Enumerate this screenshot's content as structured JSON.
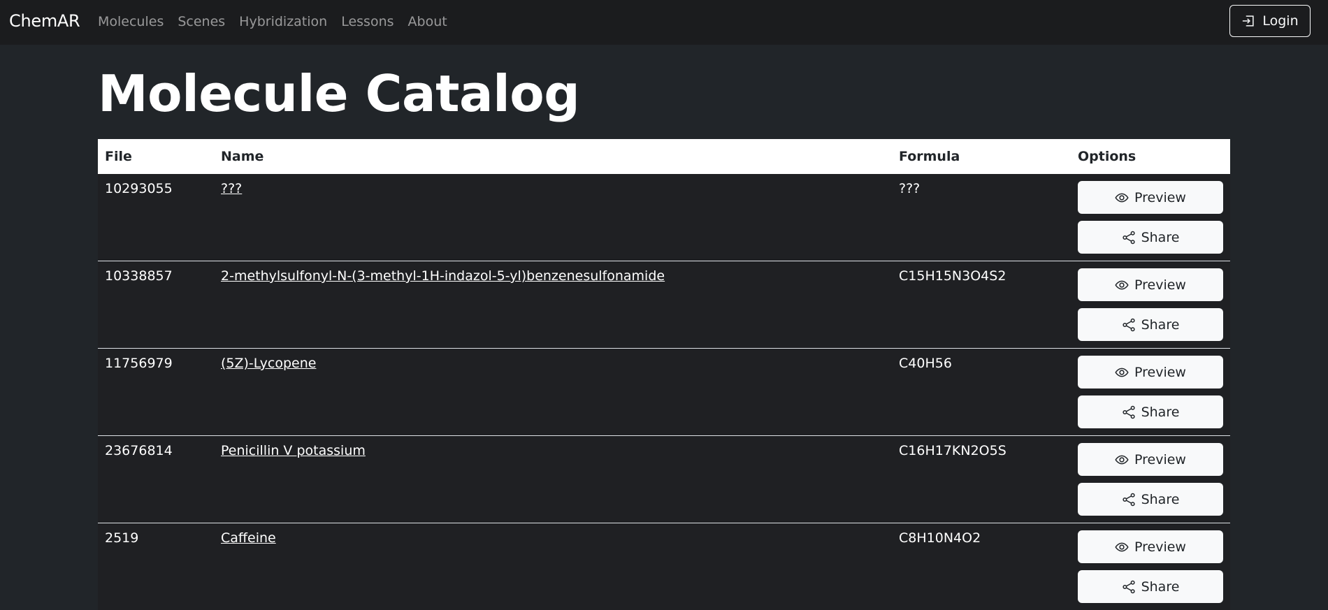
{
  "nav": {
    "brand": "ChemAR",
    "links": [
      "Molecules",
      "Scenes",
      "Hybridization",
      "Lessons",
      "About"
    ],
    "login_label": "Login"
  },
  "page": {
    "title": "Molecule Catalog"
  },
  "table": {
    "headers": [
      "File",
      "Name",
      "Formula",
      "Options"
    ],
    "preview_label": "Preview",
    "share_label": "Share",
    "rows": [
      {
        "file": "10293055",
        "name": "???",
        "formula": "???"
      },
      {
        "file": "10338857",
        "name": "2-methylsulfonyl-N-(3-methyl-1H-indazol-5-yl)benzenesulfonamide",
        "formula": "C15H15N3O4S2"
      },
      {
        "file": "11756979",
        "name": "(5Z)-Lycopene",
        "formula": "C40H56"
      },
      {
        "file": "23676814",
        "name": "Penicillin V potassium",
        "formula": "C16H17KN2O5S"
      },
      {
        "file": "2519",
        "name": "Caffeine",
        "formula": "C8H10N4O2"
      }
    ]
  }
}
